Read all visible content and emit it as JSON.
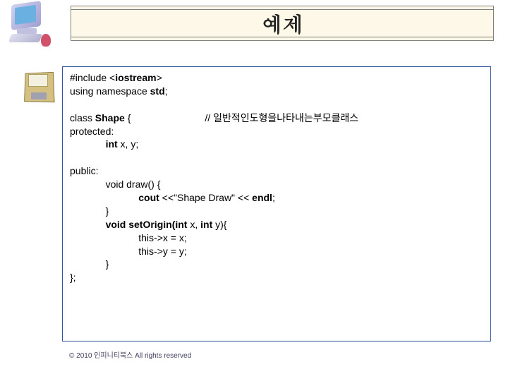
{
  "title": "예제",
  "code": {
    "l1a": "#include <",
    "l1b": "iostream",
    "l1c": ">",
    "l2a": "using namespace ",
    "l2b": "std",
    "l2c": ";",
    "blank1": " ",
    "l3a": "class ",
    "l3b": "Shape",
    "l3c": " {                           // 일반적인도형을나타내는부모클래스",
    "l4": "protected:",
    "l5a": "             int",
    "l5b": " x, y;",
    "blank2": " ",
    "l6": "public:",
    "l7a": "             void draw() {",
    "l8a": "                         cout",
    "l8b": " <<\"Shape Draw\" << ",
    "l8c": "endl",
    "l8d": ";",
    "l9": "             }",
    "l10a": "             void setOrigin(int",
    "l10b": " x, ",
    "l10c": "int",
    "l10d": " y){",
    "l11": "                         this->x = x;",
    "l12": "                         this->y = y;",
    "l13": "             }",
    "l14": "};"
  },
  "footer": "© 2010 인피니티북스 All rights reserved"
}
